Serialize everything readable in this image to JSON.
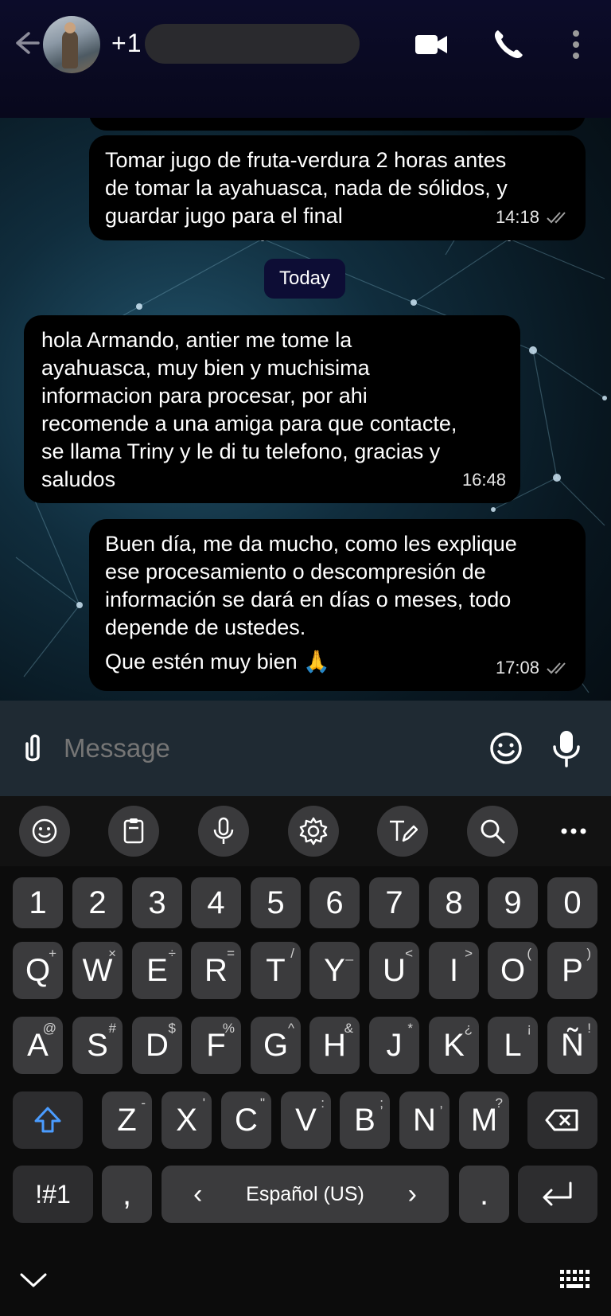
{
  "header": {
    "contact_name": "+1",
    "icons": [
      "back-arrow-icon",
      "video-call-icon",
      "phone-icon",
      "more-vert-icon"
    ]
  },
  "messages": [
    {
      "direction": "outgoing",
      "text": "Tomar jugo de fruta-verdura 2 horas antes\nde tomar la ayahuasca, nada de sólidos, y\nguardar jugo para el final",
      "time": "14:18",
      "status": "read"
    },
    {
      "direction": "incoming",
      "text": "hola Armando, antier me tome la\nayahuasca, muy bien y muchisima\ninformacion para procesar, por ahi\nrecomende a una amiga para que contacte,\nse llama Triny y le di tu telefono, gracias y\nsaludos",
      "time": "16:48"
    },
    {
      "direction": "outgoing",
      "text": "Buen día, me da mucho, como les explique\nese procesamiento o descompresión de\ninformación se dará en días o meses, todo\ndepende de ustedes.",
      "text2": "Que estén muy bien 🙏",
      "time": "17:08",
      "status": "read"
    }
  ],
  "date_separator": "Today",
  "composer": {
    "placeholder": "Message"
  },
  "keyboard": {
    "number_row": [
      "1",
      "2",
      "3",
      "4",
      "5",
      "6",
      "7",
      "8",
      "9",
      "0"
    ],
    "row1": [
      {
        "k": "Q",
        "s": "+"
      },
      {
        "k": "W",
        "s": "×"
      },
      {
        "k": "E",
        "s": "÷"
      },
      {
        "k": "R",
        "s": "="
      },
      {
        "k": "T",
        "s": "/"
      },
      {
        "k": "Y",
        "s": "_"
      },
      {
        "k": "U",
        "s": "<"
      },
      {
        "k": "I",
        "s": ">"
      },
      {
        "k": "O",
        "s": "("
      },
      {
        "k": "P",
        "s": ")"
      }
    ],
    "row2": [
      {
        "k": "A",
        "s": "@"
      },
      {
        "k": "S",
        "s": "#"
      },
      {
        "k": "D",
        "s": "$"
      },
      {
        "k": "F",
        "s": "%"
      },
      {
        "k": "G",
        "s": "^"
      },
      {
        "k": "H",
        "s": "&"
      },
      {
        "k": "J",
        "s": "*"
      },
      {
        "k": "K",
        "s": "¿"
      },
      {
        "k": "L",
        "s": "¡"
      },
      {
        "k": "Ñ",
        "s": "!"
      }
    ],
    "row3": [
      {
        "k": "Z",
        "s": "-"
      },
      {
        "k": "X",
        "s": "'"
      },
      {
        "k": "C",
        "s": "\""
      },
      {
        "k": "V",
        "s": ":"
      },
      {
        "k": "B",
        "s": ";"
      },
      {
        "k": "N",
        "s": ","
      },
      {
        "k": "M",
        "s": "?"
      }
    ],
    "symbols_label": "!#1",
    "comma": ",",
    "space_label": "Español (US)",
    "period": ".",
    "lang_prev": "‹",
    "lang_next": "›"
  }
}
